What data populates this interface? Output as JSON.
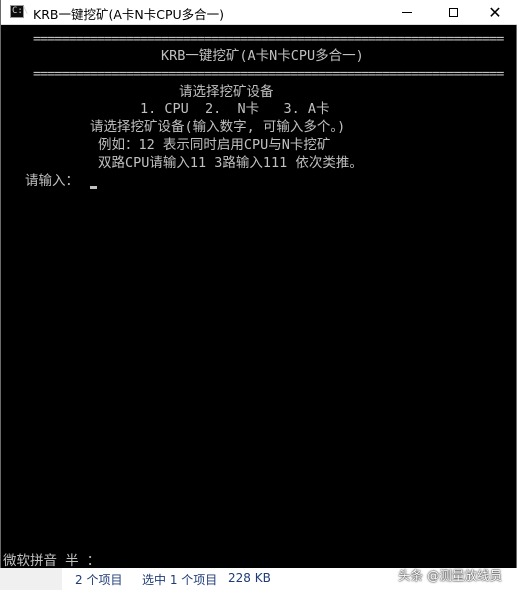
{
  "window": {
    "title": "KRB一键挖矿(A卡N卡CPU多合一)",
    "icon_label": "C:\\",
    "controls": {
      "minimize": "minimize-icon",
      "maximize": "maximize-icon",
      "close": "close-icon"
    }
  },
  "console": {
    "separator": "==================================================================",
    "header": "KRB一键挖矿(A卡N卡CPU多合一)",
    "prompt_title": "请选择挖矿设备",
    "options": "1. CPU  2.  N卡   3. A卡",
    "instruction": "请选择挖矿设备(输入数字, 可输入多个。)",
    "example1": "例如：12 表示同时启用CPU与N卡挖矿",
    "example2": "双路CPU请输入11 3路输入111 依次类推。",
    "input_prompt": "请输入：",
    "ime_status": "微软拼音 半 ："
  },
  "statusbar": {
    "items_count": "2 个项目",
    "selected": "选中 1 个项目",
    "size": "228 KB"
  },
  "watermark": "头条 @测量放线员",
  "colors": {
    "console_bg": "#000000",
    "console_text": "#c0c0c0",
    "status_text": "#1e3c78"
  }
}
